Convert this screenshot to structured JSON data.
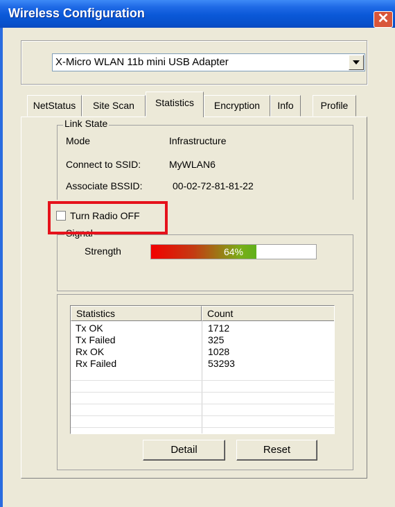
{
  "window": {
    "title": "Wireless Configuration",
    "close_glyph": "✕"
  },
  "adapter": {
    "selected": "X-Micro WLAN 11b mini USB Adapter"
  },
  "tabs": [
    {
      "label": "NetStatus"
    },
    {
      "label": "Site Scan"
    },
    {
      "label": "Statistics"
    },
    {
      "label": "Encryption"
    },
    {
      "label": "Info"
    },
    {
      "label": "Profile"
    }
  ],
  "link_state": {
    "legend": "Link State",
    "rows": [
      {
        "label": "Mode",
        "value": "Infrastructure"
      },
      {
        "label": "Connect to SSID:",
        "value": "MyWLAN6"
      },
      {
        "label": "Associate BSSID:",
        "value": "00-02-72-81-81-22"
      }
    ]
  },
  "radio": {
    "label": "Turn Radio OFF",
    "checked": false,
    "highlight_color": "#E5121B"
  },
  "signal": {
    "legend": "Signal",
    "strength_label": "Strength",
    "percent_text": "64%",
    "percent": 64
  },
  "statistics": {
    "columns": [
      "Statistics",
      "Count"
    ],
    "rows": [
      {
        "name": "Tx OK",
        "count": "1712"
      },
      {
        "name": "Tx Failed",
        "count": "325"
      },
      {
        "name": "Rx OK",
        "count": "1028"
      },
      {
        "name": "Rx Failed",
        "count": "53293"
      }
    ]
  },
  "buttons": {
    "detail": "Detail",
    "reset": "Reset"
  }
}
